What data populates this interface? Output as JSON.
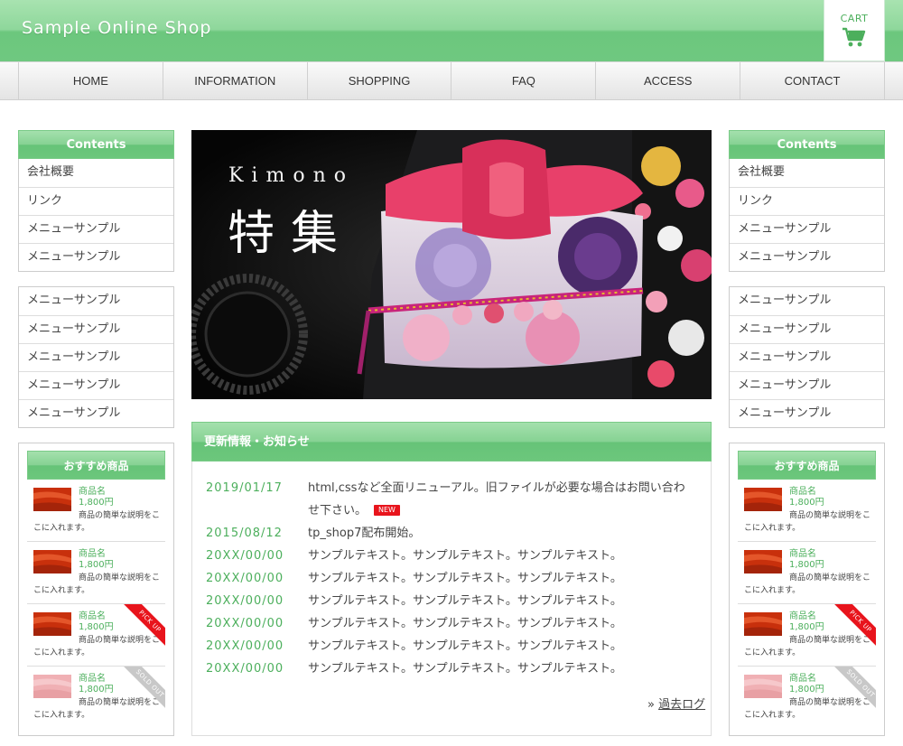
{
  "header": {
    "site_title": "Sample Online Shop",
    "cart_label": "CART",
    "cart_icon": "cart-icon"
  },
  "nav": {
    "items": [
      "HOME",
      "INFORMATION",
      "SHOPPING",
      "FAQ",
      "ACCESS",
      "CONTACT"
    ]
  },
  "left_sidebar": {
    "menu_title": "Contents",
    "menu_items": [
      "会社概要",
      "リンク",
      "メニューサンプル",
      "メニューサンプル"
    ],
    "menu2_items": [
      "メニューサンプル",
      "メニューサンプル",
      "メニューサンプル",
      "メニューサンプル",
      "メニューサンプル"
    ],
    "recommend_title": "おすすめ商品",
    "products": [
      {
        "name": "商品名",
        "price": "1,800円",
        "desc": "商品の簡単な説明をここに入れます。",
        "ribbon": ""
      },
      {
        "name": "商品名",
        "price": "1,800円",
        "desc": "商品の簡単な説明をここに入れます。",
        "ribbon": ""
      },
      {
        "name": "商品名",
        "price": "1,800円",
        "desc": "商品の簡単な説明をここに入れます。",
        "ribbon": "PICK UP"
      },
      {
        "name": "商品名",
        "price": "1,800円",
        "desc": "商品の簡単な説明をここに入れます。",
        "ribbon": "SOLD OUT"
      }
    ]
  },
  "right_sidebar": {
    "menu_title": "Contents",
    "menu_items": [
      "会社概要",
      "リンク",
      "メニューサンプル",
      "メニューサンプル"
    ],
    "menu2_items": [
      "メニューサンプル",
      "メニューサンプル",
      "メニューサンプル",
      "メニューサンプル",
      "メニューサンプル"
    ],
    "recommend_title": "おすすめ商品",
    "products": [
      {
        "name": "商品名",
        "price": "1,800円",
        "desc": "商品の簡単な説明をここに入れます。",
        "ribbon": ""
      },
      {
        "name": "商品名",
        "price": "1,800円",
        "desc": "商品の簡単な説明をここに入れます。",
        "ribbon": ""
      },
      {
        "name": "商品名",
        "price": "1,800円",
        "desc": "商品の簡単な説明をここに入れます。",
        "ribbon": "PICK UP"
      },
      {
        "name": "商品名",
        "price": "1,800円",
        "desc": "商品の簡単な説明をここに入れます。",
        "ribbon": "SOLD OUT"
      }
    ]
  },
  "hero": {
    "title_en": "Kimono",
    "title_jp": "特集"
  },
  "news": {
    "title": "更新情報・お知らせ",
    "items": [
      {
        "date": "2019/01/17",
        "text": "html,cssなど全面リニューアル。旧ファイルが必要な場合はお問い合わせ下さい。",
        "badge": "NEW"
      },
      {
        "date": "2015/08/12",
        "text": "tp_shop7配布開始。",
        "badge": ""
      },
      {
        "date": "20XX/00/00",
        "text": "サンプルテキスト。サンプルテキスト。サンプルテキスト。",
        "badge": ""
      },
      {
        "date": "20XX/00/00",
        "text": "サンプルテキスト。サンプルテキスト。サンプルテキスト。",
        "badge": ""
      },
      {
        "date": "20XX/00/00",
        "text": "サンプルテキスト。サンプルテキスト。サンプルテキスト。",
        "badge": ""
      },
      {
        "date": "20XX/00/00",
        "text": "サンプルテキスト。サンプルテキスト。サンプルテキスト。",
        "badge": ""
      },
      {
        "date": "20XX/00/00",
        "text": "サンプルテキスト。サンプルテキスト。サンプルテキスト。",
        "badge": ""
      },
      {
        "date": "20XX/00/00",
        "text": "サンプルテキスト。サンプルテキスト。サンプルテキスト。",
        "badge": ""
      }
    ],
    "past_log_prefix": "»",
    "past_log_label": "過去ログ"
  },
  "colors": {
    "accent_green": "#6cc77c",
    "text_green": "#4caf5c",
    "badge_red": "#e8141c",
    "sold_gray": "#c8c8c8"
  }
}
